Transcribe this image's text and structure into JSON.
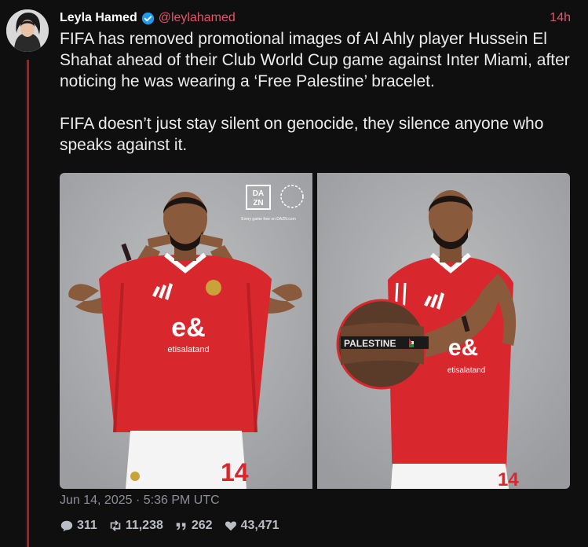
{
  "author": {
    "name": "Leyla Hamed",
    "handle": "@leylahamed",
    "time": "14h"
  },
  "tweet": {
    "paragraph_1": "FIFA has removed promotional images of Al Ahly player Hussein El Shahat ahead of their Club World Cup game against Inter Miami, after noticing he was wearing a ‘Free Palestine’ bracelet.",
    "paragraph_2": "FIFA doesn’t just stay silent on genocide, they silence anyone who speaks against it.",
    "date": "Jun 14, 2025 · 5:36 PM UTC"
  },
  "media": {
    "left": {
      "dazn_top": "DA",
      "dazn_bottom": "ZN",
      "caption": "Every game free on DAZN.com",
      "sponsor": "etisalatand",
      "number": "14"
    },
    "right": {
      "bracelet_text": "PALESTINE",
      "sponsor": "etisalatand",
      "number": "14"
    }
  },
  "stats": {
    "replies": "311",
    "retweets": "11,238",
    "quotes": "262",
    "likes": "43,471"
  },
  "colors": {
    "accent": "#e0566a",
    "thread_line": "#7a3030",
    "jersey": "#d8272d",
    "photo_bg": "#a8a9ab"
  }
}
